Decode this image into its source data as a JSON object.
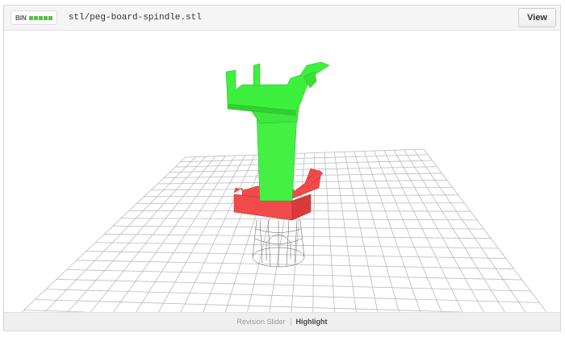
{
  "header": {
    "bin_label": "BIN",
    "file_path": "stl/peg-board-spindle.stl",
    "view_label": "View"
  },
  "footer": {
    "revision_slider_label": "Revision Slider",
    "highlight_label": "Highlight"
  },
  "colors": {
    "added": "#3ef03e",
    "removed": "#f04444",
    "bin_bar": "#54c144"
  }
}
